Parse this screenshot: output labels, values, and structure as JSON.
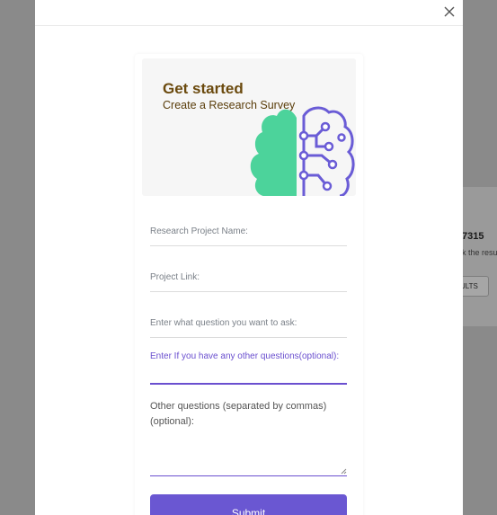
{
  "background": {
    "number_text": "7315",
    "subtext": "k the result",
    "button_label": "ULTS"
  },
  "modal": {
    "close_icon": "close-icon",
    "hero": {
      "title": "Get started",
      "subtitle": "Create a Research Survey",
      "art_icon": "brain-tree-icon",
      "colors": {
        "tree": "#4cd39b",
        "circuit": "#6a5cd6",
        "title": "#6b4a0e"
      }
    },
    "fields": [
      {
        "label": "Research Project Name:",
        "value": ""
      },
      {
        "label": "Project Link:",
        "value": ""
      },
      {
        "label": "Enter what question you want to ask:",
        "value": ""
      },
      {
        "label": "Enter If you have any other questions(optional):",
        "value": ""
      }
    ],
    "textarea": {
      "label": "Other questions (separated by commas) (optional):",
      "value": ""
    },
    "submit_label": "Submit",
    "accent_color": "#6a57d2"
  }
}
